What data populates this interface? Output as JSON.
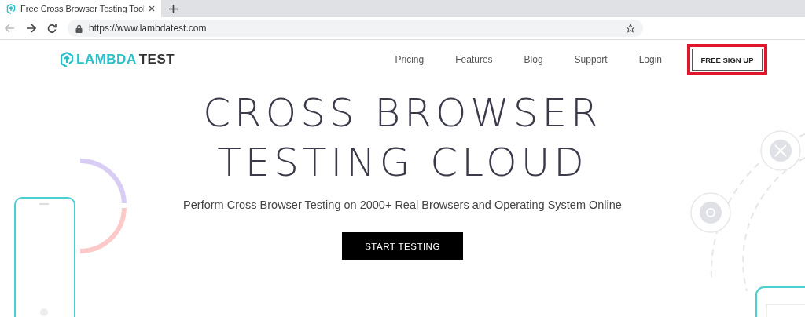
{
  "browser": {
    "tabs": [
      {
        "title": "Free Cross Browser Testing Tool",
        "selected": true
      }
    ],
    "url": "https://www.lambdatest.com"
  },
  "header": {
    "logo": {
      "primary": "LAMBDA",
      "secondary": "TEST"
    },
    "nav": [
      {
        "label": "Pricing"
      },
      {
        "label": "Features"
      },
      {
        "label": "Blog"
      },
      {
        "label": "Support"
      },
      {
        "label": "Login"
      }
    ],
    "signup_button": {
      "label": "FREE SIGN UP",
      "highlighted": true
    }
  },
  "hero": {
    "title_lines": [
      "CROSS BROWSER",
      "TESTING CLOUD"
    ],
    "subtitle": "Perform Cross Browser Testing on 2000+ Real Browsers and Operating System Online",
    "cta": "START TESTING"
  }
}
